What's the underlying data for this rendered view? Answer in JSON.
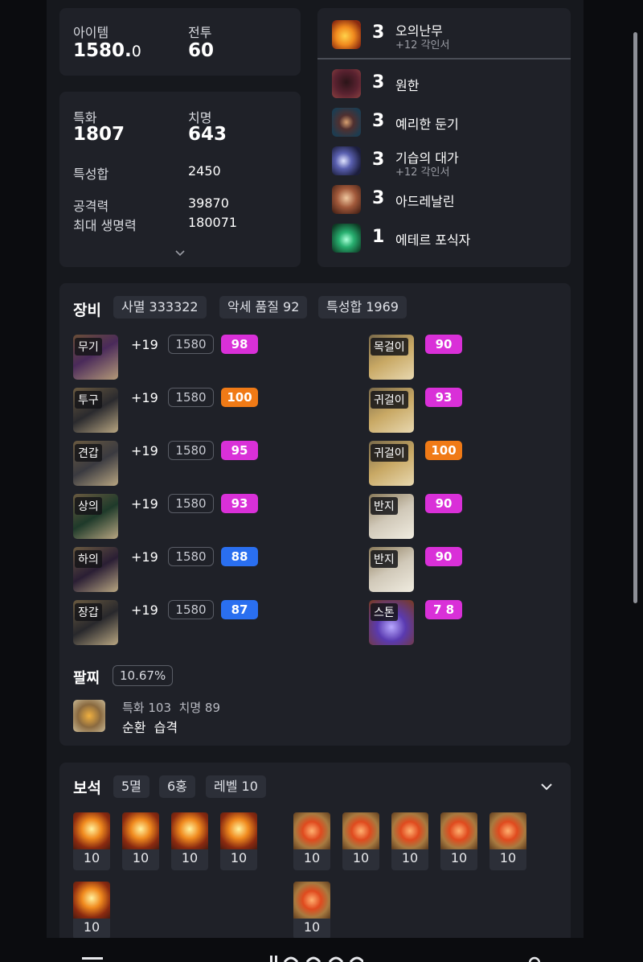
{
  "stats_top": {
    "item_label": "아이템",
    "item_value": "1580.",
    "item_decimal": "0",
    "combat_label": "전투",
    "combat_value": "60"
  },
  "stats_main": {
    "spec_label": "특화",
    "spec_value": "1807",
    "crit_label": "치명",
    "crit_value": "643",
    "sum_label": "특성합",
    "sum_value": "2450",
    "atk_label": "공격력",
    "atk_value": "39870",
    "hp_label": "최대 생명력",
    "hp_value": "180071"
  },
  "engravings": [
    {
      "level": "3",
      "name": "오의난무",
      "sub": "+12 각인서",
      "color": "#c86a1e"
    },
    {
      "level": "3",
      "name": "원한",
      "sub": "",
      "color": "#6b2a30"
    },
    {
      "level": "3",
      "name": "예리한 둔기",
      "sub": "",
      "color": "#3a4a66"
    },
    {
      "level": "3",
      "name": "기습의 대가",
      "sub": "+12 각인서",
      "color": "#3c3f78"
    },
    {
      "level": "3",
      "name": "아드레날린",
      "sub": "",
      "color": "#8a5030"
    },
    {
      "level": "1",
      "name": "에테르 포식자",
      "sub": "",
      "color": "#1f7a52"
    }
  ],
  "equipment": {
    "title": "장비",
    "tags": [
      "사멸 333322",
      "악세 품질 92",
      "특성합 1969"
    ],
    "armor": [
      {
        "slot": "무기",
        "refine": "+19",
        "ilvl": "1580",
        "quality": "98",
        "quality_color": "#d930d8"
      },
      {
        "slot": "투구",
        "refine": "+19",
        "ilvl": "1580",
        "quality": "100",
        "quality_color": "#f07a16"
      },
      {
        "slot": "견갑",
        "refine": "+19",
        "ilvl": "1580",
        "quality": "95",
        "quality_color": "#d930d8"
      },
      {
        "slot": "상의",
        "refine": "+19",
        "ilvl": "1580",
        "quality": "93",
        "quality_color": "#d930d8"
      },
      {
        "slot": "하의",
        "refine": "+19",
        "ilvl": "1580",
        "quality": "88",
        "quality_color": "#2a6ff0"
      },
      {
        "slot": "장갑",
        "refine": "+19",
        "ilvl": "1580",
        "quality": "87",
        "quality_color": "#2a6ff0"
      }
    ],
    "accessories": [
      {
        "slot": "목걸이",
        "quality": "90",
        "quality_color": "#d930d8"
      },
      {
        "slot": "귀걸이",
        "quality": "93",
        "quality_color": "#d930d8"
      },
      {
        "slot": "귀걸이",
        "quality": "100",
        "quality_color": "#f07a16"
      },
      {
        "slot": "반지",
        "quality": "90",
        "quality_color": "#d930d8"
      },
      {
        "slot": "반지",
        "quality": "90",
        "quality_color": "#d930d8"
      },
      {
        "slot": "스톤",
        "quality": "7 8",
        "quality_color": "#d930d8"
      }
    ],
    "bracelet_label": "팔찌",
    "bracelet_percent": "10.67%",
    "bracelet_line1": "특화 103  치명 89",
    "bracelet_line2": "순환  습격"
  },
  "gems": {
    "title": "보석",
    "tags": [
      "5멸",
      "6홍",
      "레벨 10"
    ],
    "left": [
      "10",
      "10",
      "10",
      "10",
      "10"
    ],
    "right": [
      "10",
      "10",
      "10",
      "10",
      "10",
      "10"
    ]
  }
}
